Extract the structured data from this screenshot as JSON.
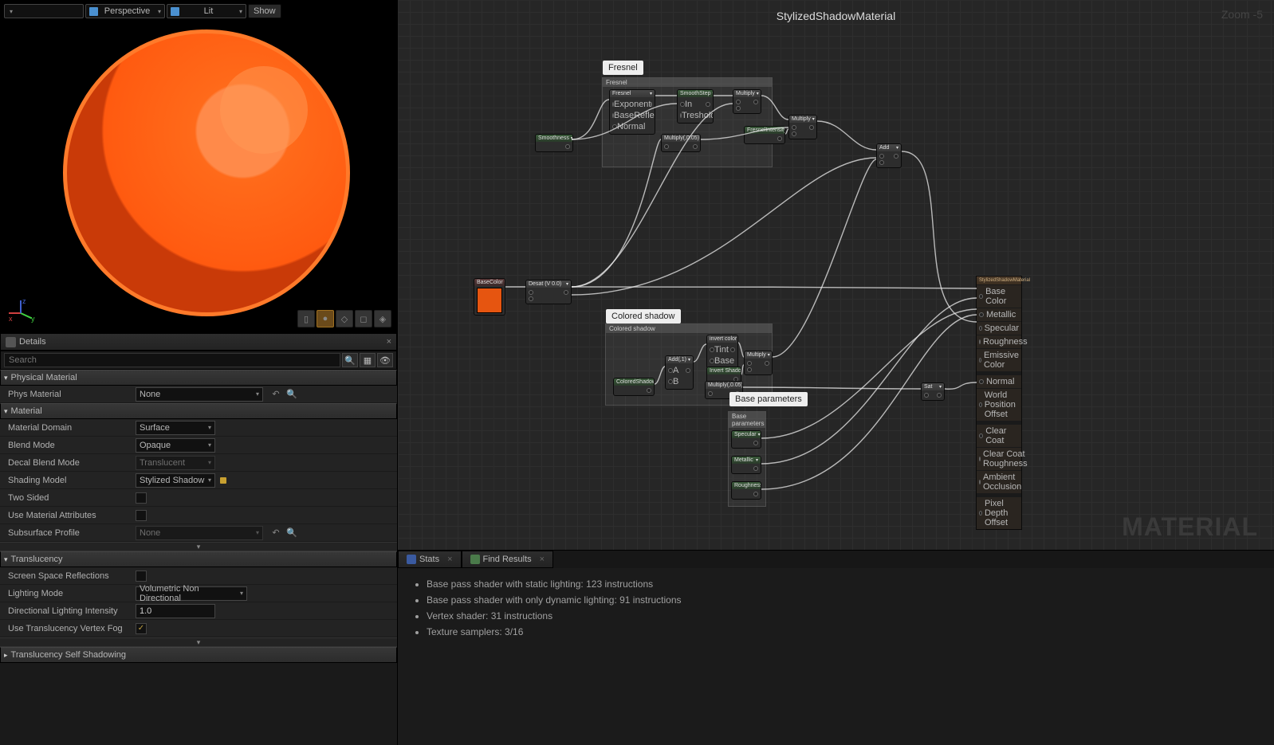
{
  "viewport": {
    "perspective": "Perspective",
    "lit": "Lit",
    "show": "Show",
    "gizmo": {
      "x": "x",
      "y": "y",
      "z": "z"
    }
  },
  "details": {
    "title": "Details",
    "search_placeholder": "Search"
  },
  "sections": {
    "physical_material": "Physical Material",
    "material": "Material",
    "translucency": "Translucency",
    "translucency_self_shadow": "Translucency Self Shadowing"
  },
  "props": {
    "phys_material": {
      "label": "Phys Material",
      "value": "None"
    },
    "material_domain": {
      "label": "Material Domain",
      "value": "Surface"
    },
    "blend_mode": {
      "label": "Blend Mode",
      "value": "Opaque"
    },
    "decal_blend_mode": {
      "label": "Decal Blend Mode",
      "value": "Translucent"
    },
    "shading_model": {
      "label": "Shading Model",
      "value": "Stylized Shadow"
    },
    "two_sided": {
      "label": "Two Sided"
    },
    "use_material_attributes": {
      "label": "Use Material Attributes"
    },
    "subsurface_profile": {
      "label": "Subsurface Profile",
      "value": "None"
    },
    "screen_space_reflections": {
      "label": "Screen Space Reflections"
    },
    "lighting_mode": {
      "label": "Lighting Mode",
      "value": "Volumetric Non Directional"
    },
    "directional_lighting_intensity": {
      "label": "Directional Lighting Intensity",
      "value": "1.0"
    },
    "use_translucency_vertex_fog": {
      "label": "Use Translucency Vertex Fog"
    }
  },
  "graph": {
    "title": "StylizedShadowMaterial",
    "zoom": "Zoom -5",
    "watermark": "MATERIAL",
    "tooltips": {
      "fresnel": "Fresnel",
      "colored_shadow": "Colored shadow",
      "base_params": "Base parameters"
    },
    "comments": {
      "fresnel": "Fresnel",
      "colored_shadow": "Colored shadow",
      "base_params": "Base parameters"
    },
    "nodes": {
      "basecolor": {
        "title": "BaseColor"
      },
      "desat": {
        "title": "Desat (V 0.0)"
      },
      "smoothness": {
        "title": "Smoothness"
      },
      "fresnel": {
        "title": "Fresnel",
        "pins": [
          "Exponent",
          "BaseReflectFraction",
          "Normal"
        ]
      },
      "smoothstep": {
        "title": "SmoothStep",
        "pins": [
          "In",
          "Treshold"
        ]
      },
      "multiply": {
        "title": "Multiply"
      },
      "multiply2": {
        "title": "Multiply"
      },
      "fresnel_intensity": {
        "title": "FresnelIntensity"
      },
      "multiply_a": {
        "title": "Multiply(,0.05)"
      },
      "add_node": {
        "title": "Add"
      },
      "colored_shadow": {
        "title": "ColoredShadow"
      },
      "add_l": {
        "title": "Add(,1)",
        "pins": [
          "A",
          "B"
        ]
      },
      "invert_color": {
        "title": "invert color",
        "pins": [
          "Tint",
          "Base"
        ]
      },
      "multiply3": {
        "title": "Multiply"
      },
      "invert_shadow": {
        "title": "Invert Shadow"
      },
      "specular": {
        "title": "Specular"
      },
      "metallic": {
        "title": "Metallic"
      },
      "roughness": {
        "title": "Roughness"
      },
      "sat": {
        "title": "Sat"
      },
      "multiply_s": {
        "title": "Multiply(,0.05)"
      }
    },
    "output": {
      "title": "StylizedShadowMaterial",
      "pins": [
        "Base Color",
        "Metallic",
        "Specular",
        "Roughness",
        "Emissive Color",
        "",
        "Normal",
        "World Position Offset",
        "",
        "",
        "Clear Coat",
        "Clear Coat Roughness",
        "Ambient Occlusion",
        "",
        "Pixel Depth Offset"
      ]
    }
  },
  "tabs": {
    "stats": "Stats",
    "find_results": "Find Results"
  },
  "stats": [
    "Base pass shader with static lighting: 123 instructions",
    "Base pass shader with only dynamic lighting: 91 instructions",
    "Vertex shader: 31 instructions",
    "Texture samplers: 3/16"
  ]
}
